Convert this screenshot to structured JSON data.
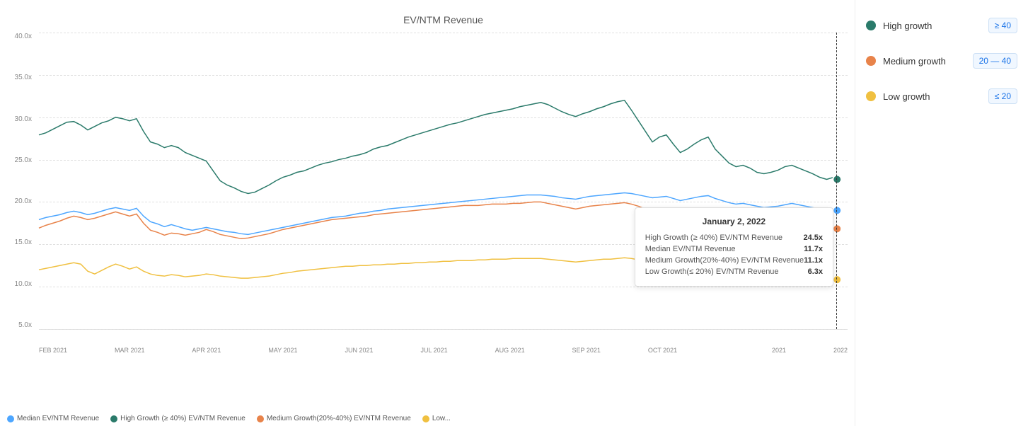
{
  "chart": {
    "title": "EV/NTM Revenue",
    "yLabels": [
      "40.0x",
      "35.0x",
      "30.0x",
      "25.0x",
      "20.0x",
      "15.0x",
      "10.0x",
      "5.0x"
    ],
    "xLabels": [
      "FEB 2021",
      "MAR 2021",
      "APR 2021",
      "MAY 2021",
      "JUN 2021",
      "JUL 2021",
      "AUG 2021",
      "SEP 2021",
      "OCT 2021",
      "",
      "2021",
      "2022"
    ],
    "dashedLineLabel": "January 2, 2022"
  },
  "legend": {
    "items": [
      {
        "label": "Median EV/NTM Revenue",
        "color": "#4da6ff"
      },
      {
        "label": "High Growth (≥ 40%) EV/NTM Revenue",
        "color": "#2a7a6a"
      },
      {
        "label": "Medium Growth(20%-40%) EV/NTM Revenue",
        "color": "#e8834a"
      },
      {
        "label": "Low...",
        "color": "#f0c040"
      }
    ]
  },
  "sidebar": {
    "items": [
      {
        "label": "High growth",
        "color": "#2a7a6a",
        "badge": "≥  40"
      },
      {
        "label": "Medium growth",
        "color": "#e8834a",
        "badge": "20 — 40"
      },
      {
        "label": "Low growth",
        "color": "#f0c040",
        "badge": "≤  20"
      }
    ]
  },
  "tooltip": {
    "date": "January 2, 2022",
    "rows": [
      {
        "key": "High Growth (≥ 40%) EV/NTM Revenue",
        "value": "24.5x"
      },
      {
        "key": "Median EV/NTM Revenue",
        "value": "11.7x"
      },
      {
        "key": "Medium Growth(20%-40%) EV/NTM Revenue",
        "value": "11.1x"
      },
      {
        "key": "Low Growth(≤ 20%) EV/NTM Revenue",
        "value": "6.3x"
      }
    ]
  }
}
